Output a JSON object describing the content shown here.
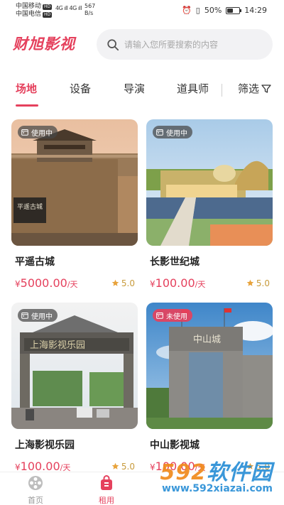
{
  "status_bar": {
    "carrier1": "中国移动",
    "carrier2": "中国电信",
    "hd": "HD",
    "signal": "4G ıll 4G ıll",
    "speed_value": "567",
    "speed_unit": "B/s",
    "battery_percent": "50%",
    "battery_level": 0.5,
    "time": "14:29"
  },
  "header": {
    "logo": "财旭影视",
    "search_placeholder": "请输入您所要搜索的内容"
  },
  "tabs": {
    "items": [
      "场地",
      "设备",
      "导演",
      "道具师"
    ],
    "active_index": 0,
    "filter_label": "筛选"
  },
  "listings": [
    {
      "name": "平遥古城",
      "price": "5000.00",
      "unit": "/天",
      "rating": "5.0",
      "status": "使用中",
      "currency": "¥"
    },
    {
      "name": "长影世纪城",
      "price": "100.00",
      "unit": "/天",
      "rating": "5.0",
      "status": "使用中",
      "currency": "¥"
    },
    {
      "name": "上海影视乐园",
      "price": "100.00",
      "unit": "/天",
      "rating": "5.0",
      "status": "使用中",
      "currency": "¥"
    },
    {
      "name": "中山影视城",
      "price": "100.00",
      "unit": "/天",
      "rating": "5.0",
      "status": "未使用",
      "currency": "¥"
    }
  ],
  "bottom_nav": {
    "items": [
      {
        "label": "首页",
        "icon": "film-reel-icon",
        "active": false
      },
      {
        "label": "租用",
        "icon": "bag-icon",
        "active": true
      }
    ]
  },
  "watermark": {
    "brand_prefix": "592",
    "brand_suffix": "软件园",
    "url": "www.592xiazai.com"
  },
  "colors": {
    "accent": "#e5415d",
    "rating": "#c89b3c",
    "watermark_blue": "#2a8fd6",
    "watermark_orange": "#f08a1c"
  }
}
